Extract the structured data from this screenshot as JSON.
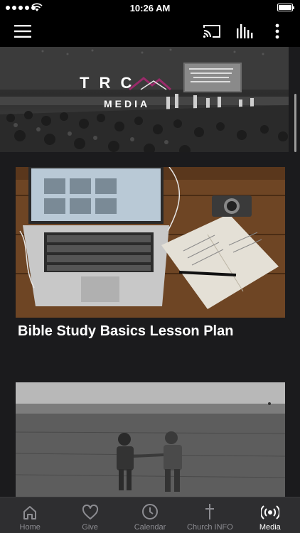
{
  "status": {
    "time": "10:26 AM"
  },
  "hero": {
    "logo_text": "T R C",
    "logo_sub": "MEDIA",
    "screen_text": "He's the Beginning and the End\nMuch more than any Stories\nHe's the Son of Man\nHe's reaching back creation"
  },
  "cards": [
    {
      "title": "Bible Study Basics Lesson Plan"
    },
    {
      "title": ""
    }
  ],
  "tabs": [
    {
      "label": "Home",
      "icon": "home-icon"
    },
    {
      "label": "Give",
      "icon": "heart-icon"
    },
    {
      "label": "Calendar",
      "icon": "clock-icon"
    },
    {
      "label": "Church INFO",
      "icon": "cross-icon"
    },
    {
      "label": "Media",
      "icon": "broadcast-icon",
      "active": true
    }
  ],
  "colors": {
    "accent_logo": "#9a2a6a",
    "tab_active": "#ffffff",
    "tab_inactive": "#8d8d92"
  }
}
